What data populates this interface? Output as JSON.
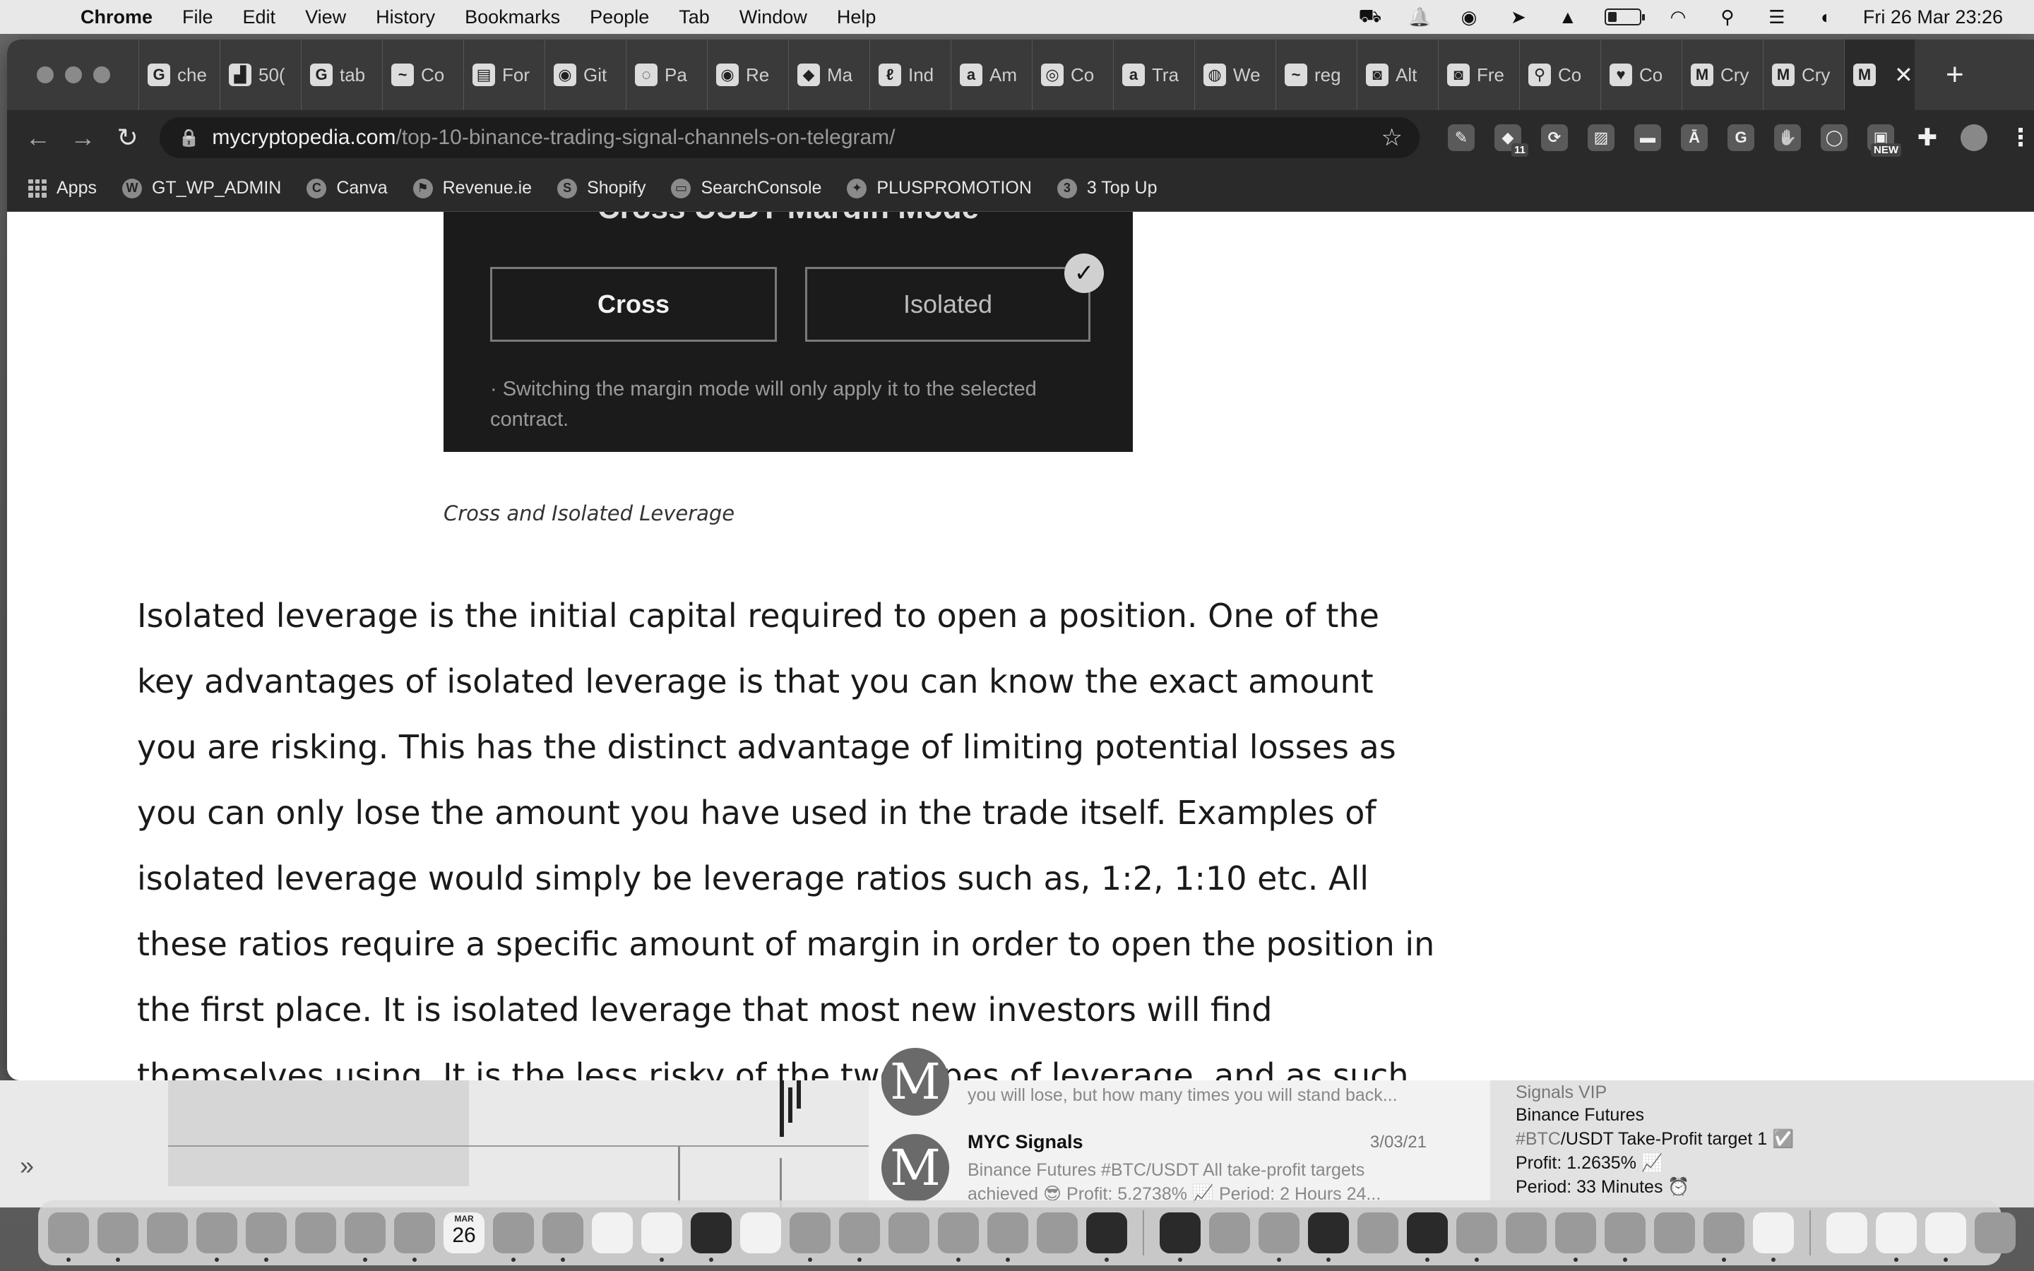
{
  "menubar": {
    "app": "Chrome",
    "items": [
      "File",
      "Edit",
      "View",
      "History",
      "Bookmarks",
      "People",
      "Tab",
      "Window",
      "Help"
    ],
    "clock": "Fri 26 Mar  23:26"
  },
  "tabs": [
    {
      "icon": "G",
      "label": "che"
    },
    {
      "icon": "▟",
      "label": "50("
    },
    {
      "icon": "G",
      "label": "tab"
    },
    {
      "icon": "~",
      "label": "Co"
    },
    {
      "icon": "▤",
      "label": "For"
    },
    {
      "icon": "◉",
      "label": "Git"
    },
    {
      "icon": "◌",
      "label": "Pa"
    },
    {
      "icon": "◉",
      "label": "Re"
    },
    {
      "icon": "◆",
      "label": "Ma"
    },
    {
      "icon": "ℓ",
      "label": "Ind"
    },
    {
      "icon": "a",
      "label": "Am"
    },
    {
      "icon": "◎",
      "label": "Co"
    },
    {
      "icon": "a",
      "label": "Tra"
    },
    {
      "icon": "◍",
      "label": "We"
    },
    {
      "icon": "~",
      "label": "reg"
    },
    {
      "icon": "◙",
      "label": "Alt"
    },
    {
      "icon": "◙",
      "label": "Fre"
    },
    {
      "icon": "⚲",
      "label": "Co"
    },
    {
      "icon": "♥",
      "label": "Co"
    },
    {
      "icon": "M",
      "label": "Cry"
    },
    {
      "icon": "M",
      "label": "Cry"
    },
    {
      "icon": "M",
      "label": "",
      "active": true
    }
  ],
  "omnibox": {
    "host": "mycryptopedia.com",
    "path": "/top-10-binance-trading-signal-channels-on-telegram/"
  },
  "extensions": [
    {
      "icon": "✎",
      "badge": ""
    },
    {
      "icon": "◆",
      "badge": "11"
    },
    {
      "icon": "⟳",
      "badge": ""
    },
    {
      "icon": "▨",
      "badge": ""
    },
    {
      "icon": "▬",
      "badge": ""
    },
    {
      "icon": "Ā",
      "badge": ""
    },
    {
      "icon": "G",
      "badge": ""
    },
    {
      "icon": "✋",
      "badge": ""
    },
    {
      "icon": "◯",
      "badge": ""
    },
    {
      "icon": "▣",
      "badge": "NEW"
    }
  ],
  "bookmarks": [
    {
      "icon": "",
      "label": "Apps",
      "kind": "apps"
    },
    {
      "icon": "W",
      "label": "GT_WP_ADMIN"
    },
    {
      "icon": "C",
      "label": "Canva"
    },
    {
      "icon": "⚑",
      "label": "Revenue.ie"
    },
    {
      "icon": "S",
      "label": "Shopify"
    },
    {
      "icon": "▭",
      "label": "SearchConsole"
    },
    {
      "icon": "✦",
      "label": "PLUSPROMOTION"
    },
    {
      "icon": "3",
      "label": "3 Top Up"
    }
  ],
  "figure": {
    "title": "Cross USDT Margin Mode",
    "cross_label": "Cross",
    "isolated_label": "Isolated",
    "note": "· Switching the margin mode will only apply it to the selected contract."
  },
  "caption": "Cross and Isolated Leverage",
  "article": "Isolated leverage is the initial capital required to open a position. One of the key advantages of isolated leverage is that you can know the exact amount you are risking. This has the distinct advantage of limiting potential losses as you can only lose the amount you have used in the trade itself. Examples of isolated leverage would simply be leverage ratios such as, 1:2, 1:10 etc. All these ratios require a specific amount of margin in order to open the position in the first place. It is isolated leverage that most new investors will find themselves using. It is the less risky of the two types of leverage, and as such, should predominantly be used by",
  "background_chat": {
    "prev_preview": "you will lose, but how many times you will stand back...",
    "name": "MYC Signals",
    "date": "3/03/21",
    "preview_1": "Binance Futures #BTC/USDT All take-profit targets",
    "preview_2": "achieved 😎 Profit: 5.2738% 📈 Period: 2 Hours 24..."
  },
  "background_signals": {
    "channel": "Signals VIP",
    "line1": "Binance Futures",
    "tag": "#BTC",
    "line2_rest": "/USDT Take-Profit target 1 ✅",
    "line3": "Profit: 1.2635% 📈",
    "line4": "Period: 33 Minutes ⏰"
  },
  "dock": {
    "calendar_month": "MAR",
    "calendar_day": "26",
    "apps": [
      "finder",
      "launchpad",
      "safari",
      "messages",
      "mail",
      "maps",
      "photos",
      "facetime",
      "calendar",
      "downloads",
      "contacts",
      "reminders",
      "notes",
      "tv",
      "help",
      "music",
      "podcasts",
      "appstore",
      "sysprefs",
      "chrome",
      "zoom",
      "obs",
      "activity",
      "whatsapp",
      "forklift",
      "terminal",
      "telegram",
      "sublime",
      "word",
      "vlc",
      "spider",
      "messenger",
      "screenshot",
      "excel",
      "preview",
      "files",
      "textedit",
      "doc",
      "trash"
    ]
  },
  "colors": {
    "accent": "#1a1a1a",
    "figure_bg": "#1b1b1b"
  }
}
